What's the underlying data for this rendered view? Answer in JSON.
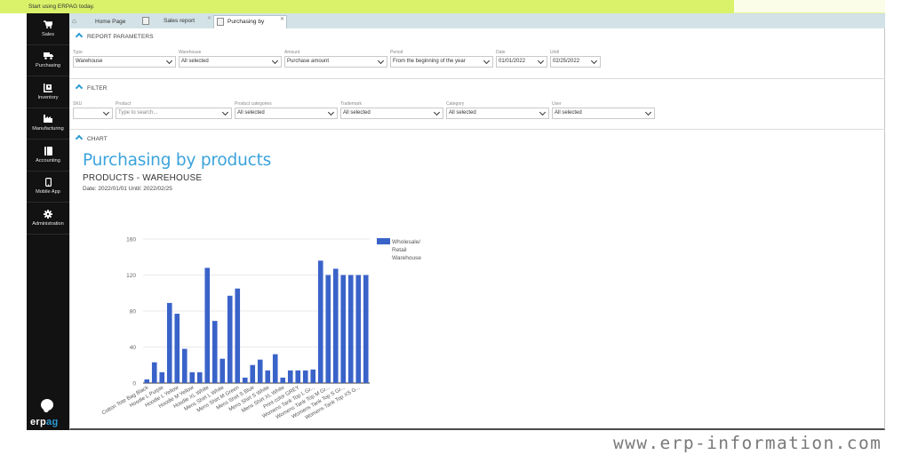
{
  "banner": {
    "text": "Start using ERPAG today."
  },
  "sidebar": {
    "items": [
      {
        "label": "Sales",
        "icon": "cart-icon",
        "glyph": "🛒"
      },
      {
        "label": "Purchasing",
        "icon": "truck-icon",
        "glyph": "⛟"
      },
      {
        "label": "Inventory",
        "icon": "inventory-icon",
        "glyph": "▣"
      },
      {
        "label": "Manufacturing",
        "icon": "factory-icon",
        "glyph": "▙"
      },
      {
        "label": "Accounting",
        "icon": "ledger-icon",
        "glyph": "▮"
      },
      {
        "label": "Mobile App",
        "icon": "mobile-icon",
        "glyph": "▯"
      },
      {
        "label": "Administration",
        "icon": "gear-icon",
        "glyph": "✱"
      }
    ],
    "logo": {
      "main": "erp",
      "accent": "ag"
    }
  },
  "tabs": {
    "home": "Home Page",
    "sales": "Sales report",
    "active": "Purchasing by products",
    "close_glyph": "✕"
  },
  "report_parameters": {
    "title": "REPORT PARAMETERS",
    "fields": [
      {
        "label": "Type",
        "value": "Warehouse"
      },
      {
        "label": "Warehouse",
        "value": "All selected"
      },
      {
        "label": "Amount",
        "value": "Purchase amount"
      },
      {
        "label": "Period",
        "value": "From the beginning of the year"
      },
      {
        "label": "Date",
        "value": "01/01/2022"
      },
      {
        "label": "Until",
        "value": "02/25/2022"
      }
    ]
  },
  "filter": {
    "title": "FILTER",
    "fields": [
      {
        "label": "SKU",
        "value": ""
      },
      {
        "label": "Product",
        "value": "",
        "placeholder": "Type to search..."
      },
      {
        "label": "Product categories",
        "value": "All selected"
      },
      {
        "label": "Trademark",
        "value": "All selected"
      },
      {
        "label": "Category",
        "value": "All selected"
      },
      {
        "label": "User",
        "value": "All selected"
      }
    ]
  },
  "chart_section": {
    "title": "CHART",
    "heading": "Purchasing by products",
    "subheading": "PRODUCTS - WAREHOUSE",
    "date_range": "Date: 2022/01/01 Until: 2022/02/25"
  },
  "chart_data": {
    "type": "bar",
    "title": "Purchasing by products",
    "xlabel": "",
    "ylabel": "",
    "ylim": [
      0,
      160
    ],
    "yticks": [
      0,
      40,
      80,
      120,
      160
    ],
    "grid": true,
    "legend": "top-right",
    "bar_color": "#3a63c9",
    "categories": [
      "Cotton Tote Bag Black",
      "",
      "Hoodie L Purple",
      "",
      "Hoodie L Yellow",
      "",
      "Hoodie M Yellow",
      "",
      "Hoodie XL White",
      "",
      "Mens Shirt L White",
      "",
      "Mens Shirt M Green",
      "",
      "Mens Shirt S Blue",
      "",
      "Mens Shirt S White",
      "",
      "Mens Shirt XL White",
      "",
      "Print color GREY",
      "",
      "Womens Tank Top L Gr...",
      "",
      "Womens Tank Top M Gr...",
      "",
      "Womens Tank Top S Gr...",
      "",
      "Womens Tank Top XS G...",
      ""
    ],
    "series": [
      {
        "name": "Wholesale/ Retail Warehouse",
        "values": [
          4,
          23,
          12,
          89,
          77,
          38,
          12,
          12,
          128,
          69,
          27,
          97,
          105,
          6,
          20,
          26,
          14,
          32,
          6,
          14,
          14,
          14,
          15,
          136,
          120,
          127,
          120,
          120,
          120,
          120
        ]
      }
    ],
    "legend_lines": [
      "Wholesale/",
      "Retail",
      "Warehouse"
    ]
  },
  "watermark": "www.erp-information.com"
}
